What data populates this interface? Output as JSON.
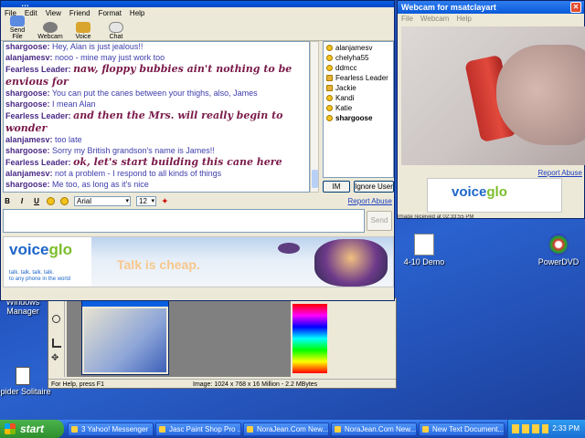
{
  "chat": {
    "title": "…",
    "menu": [
      "File",
      "Edit",
      "View",
      "Friend",
      "Format",
      "Help"
    ],
    "toolbar": [
      "Send File",
      "Webcam",
      "Voice",
      "Chat"
    ],
    "messages": [
      {
        "name": "shargoose:",
        "text": "Hey, Alan is just jealous!!",
        "fancy": false
      },
      {
        "name": "alanjamesv:",
        "text": "nooo - mine may just work too",
        "fancy": false
      },
      {
        "name": "Fearless Leader:",
        "text": "naw, floppy bubbies ain't nothing to be envious for",
        "fancy": true
      },
      {
        "name": "shargoose:",
        "text": "You can put the canes between your thighs, also, James",
        "fancy": false
      },
      {
        "name": "shargoose:",
        "text": "I mean Alan",
        "fancy": false
      },
      {
        "name": "Fearless Leader:",
        "text": "and then the Mrs. will really begin to wonder",
        "fancy": true
      },
      {
        "name": "alanjamesv:",
        "text": "too late",
        "fancy": false
      },
      {
        "name": "shargoose:",
        "text": "Sorry my British grandson's name is James!!",
        "fancy": false
      },
      {
        "name": "Fearless Leader:",
        "text": "ok, let's start building this cane here",
        "fancy": true
      },
      {
        "name": "alanjamesv:",
        "text": "not a problem - I respond to all kinds of things",
        "fancy": false
      },
      {
        "name": "shargoose:",
        "text": "Me too, as long as it's nice",
        "fancy": false
      }
    ],
    "users": [
      "alanjamesv",
      "chelyha55",
      "ddmcc",
      "Fearless Leader",
      "Jackie",
      "Kandi",
      "Katie",
      "shargoose"
    ],
    "im_button": "IM",
    "ignore_button": "Ignore User",
    "report_abuse": "Report Abuse",
    "format": {
      "bold": "B",
      "italic": "I",
      "underline": "U",
      "font": "Arial",
      "size": "12"
    },
    "send_button": "Send",
    "banner": {
      "brand_a": "voice",
      "brand_b": "glo",
      "tagline": "talk. talk. talk. talk.",
      "tagline2": "to any phone in the world",
      "slogan": "Talk is cheap."
    }
  },
  "webcam": {
    "title": "Webcam for msatclayart",
    "menu": [
      "File",
      "Webcam",
      "Help"
    ],
    "report_abuse": "Report Abuse",
    "status": "Image received at 02:33:55 PM"
  },
  "desktop": {
    "icons": [
      "4-10 Demo",
      "PowerDVD",
      "Windows Manager",
      "Spider Solitaire"
    ]
  },
  "psp": {
    "status_left": "For Help, press F1",
    "status_image": "Image: 1024 x 768 x 16 Million - 2.2 MBytes"
  },
  "taskbar": {
    "start": "start",
    "tasks": [
      "3 Yahoo! Messenger",
      "Jasc Paint Shop Pro ...",
      "NoraJean.Com New...",
      "NoraJean.Com New...",
      "New Text Document..."
    ],
    "clock": "2:33 PM"
  },
  "colors": {
    "xp_blue": "#0a5fe0",
    "start_green": "#2d8f2d",
    "name_purple": "#4a2a86",
    "fancy_maroon": "#7a1a4a"
  }
}
